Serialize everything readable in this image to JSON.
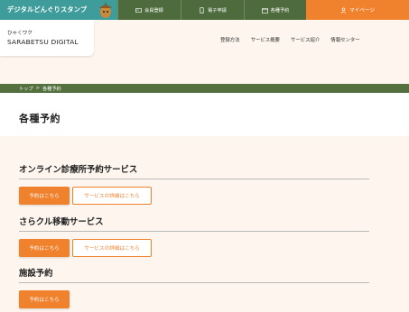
{
  "colors": {
    "header_green": "#4d6b3c",
    "accent_orange": "#f0812d",
    "stamp_teal": "#3e9c9a",
    "page_bg": "#fdf5ee"
  },
  "topbar": {
    "stamp_label": "デジタルどんぐりスタンプ",
    "items": [
      {
        "label": "会員登録",
        "icon": "member-card-icon"
      },
      {
        "label": "電子申請",
        "icon": "smartphone-icon"
      },
      {
        "label": "各種予約",
        "icon": "calendar-icon"
      },
      {
        "label": "マイページ",
        "icon": "user-icon"
      }
    ]
  },
  "header": {
    "logo_small": "ひゃくワク",
    "logo_main": "SARABETSU DIGITAL",
    "nav": [
      {
        "label": "登録方法"
      },
      {
        "label": "サービス概要"
      },
      {
        "label": "サービス紹介"
      },
      {
        "label": "情報センター"
      }
    ]
  },
  "breadcrumb": {
    "home": "トップ",
    "separator": ">",
    "current": "各種予約"
  },
  "page": {
    "title": "各種予約"
  },
  "sections": [
    {
      "heading": "オンライン診療所予約サービス",
      "primary_label": "予約はこちら",
      "detail_label": "サービスの詳細はこちら"
    },
    {
      "heading": "さらクル移動サービス",
      "primary_label": "予約はこちら",
      "detail_label": "サービスの詳細はこちら"
    },
    {
      "heading": "施設予約",
      "primary_label": "予約はこちら"
    }
  ]
}
